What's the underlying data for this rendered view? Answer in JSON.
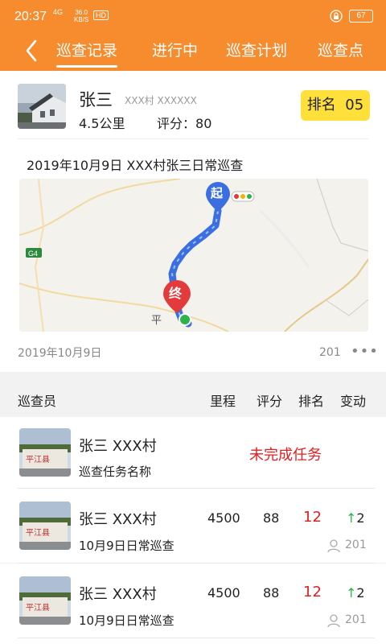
{
  "status_bar": {
    "time": "20:37",
    "network": "4G",
    "speed_value": "36.0",
    "speed_unit": "KB/S",
    "hd": "HD",
    "battery": "67"
  },
  "nav": {
    "tabs": [
      {
        "label": "巡查记录",
        "active": true
      },
      {
        "label": "进行中",
        "active": false
      },
      {
        "label": "巡查计划",
        "active": false
      },
      {
        "label": "巡查点",
        "active": false
      }
    ]
  },
  "summary": {
    "name": "张三",
    "village": "XXX村 XXXXXX",
    "distance": "4.5公里",
    "score_label": "评分：",
    "score": "80",
    "rank_label": "排名",
    "rank": "05"
  },
  "trip": {
    "title": "2019年10月9日  XXX村张三日常巡查",
    "date": "2019年10月9日",
    "views": "201",
    "more": "•••",
    "map": {
      "start_label": "起",
      "end_label": "终",
      "road_label": "G4",
      "place_label": "平"
    }
  },
  "table": {
    "headers": [
      "巡查员",
      "里程",
      "评分",
      "排名",
      "变动"
    ],
    "rows": [
      {
        "name": "张三  XXX村",
        "task": "巡查任务名称",
        "status": "未完成任务"
      },
      {
        "name": "张三  XXX村",
        "task": "10月9日日常巡查",
        "distance": "4500",
        "score": "88",
        "rank": "12",
        "change": "2",
        "views": "201"
      },
      {
        "name": "张三  XXX村",
        "task": "10月9日日常巡查",
        "distance": "4500",
        "score": "88",
        "rank": "12",
        "change": "2",
        "views": "201"
      }
    ]
  },
  "colors": {
    "brand_orange": "#f78c2e",
    "rank_yellow": "#ffe03a",
    "alert_red": "#e02020",
    "up_green": "#2db34a"
  }
}
